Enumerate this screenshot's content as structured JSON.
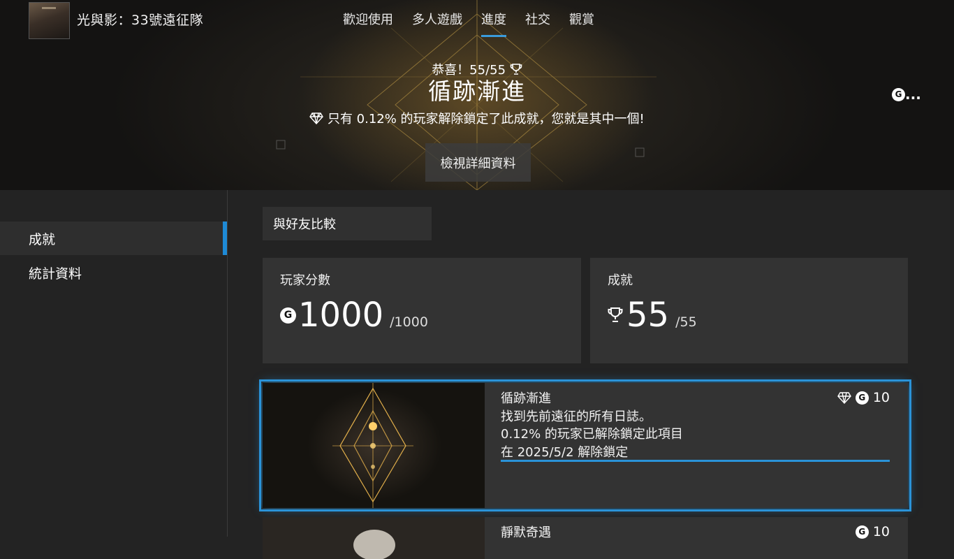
{
  "header": {
    "game_title": "光與影：33號遠征隊",
    "nav": [
      "歡迎使用",
      "多人遊戲",
      "進度",
      "社交",
      "觀賞"
    ],
    "active_nav": "進度"
  },
  "hero": {
    "congrats": "恭喜！55/55",
    "achievement_name": "循跡漸進",
    "rarity_text": "只有 0.12% 的玩家解除鎖定了此成就，您就是其中一個!",
    "detail_button": "檢視詳細資料",
    "corner_label": "...",
    "gamerscore_glyph": "G"
  },
  "sidebar": {
    "items": [
      {
        "label": "成就",
        "active": true
      },
      {
        "label": "統計資料",
        "active": false
      }
    ]
  },
  "main": {
    "compare_button": "與好友比較",
    "stats": [
      {
        "label": "玩家分數",
        "value": "1000",
        "total": "/1000",
        "icon": "gamerscore-icon"
      },
      {
        "label": "成就",
        "value": "55",
        "total": "/55",
        "icon": "trophy-icon"
      }
    ],
    "achievements": [
      {
        "title": "循跡漸進",
        "description": "找到先前遠征的所有日誌。",
        "rarity": "0.12% 的玩家已解除鎖定此項目",
        "unlocked": "在 2025/5/2 解除鎖定",
        "score": "10",
        "rare": true
      },
      {
        "title": "靜默奇遇",
        "score": "10",
        "rare": false
      }
    ]
  },
  "colors": {
    "accent": "#2a93d8",
    "card_bg": "#333333",
    "page_bg": "#232323"
  }
}
